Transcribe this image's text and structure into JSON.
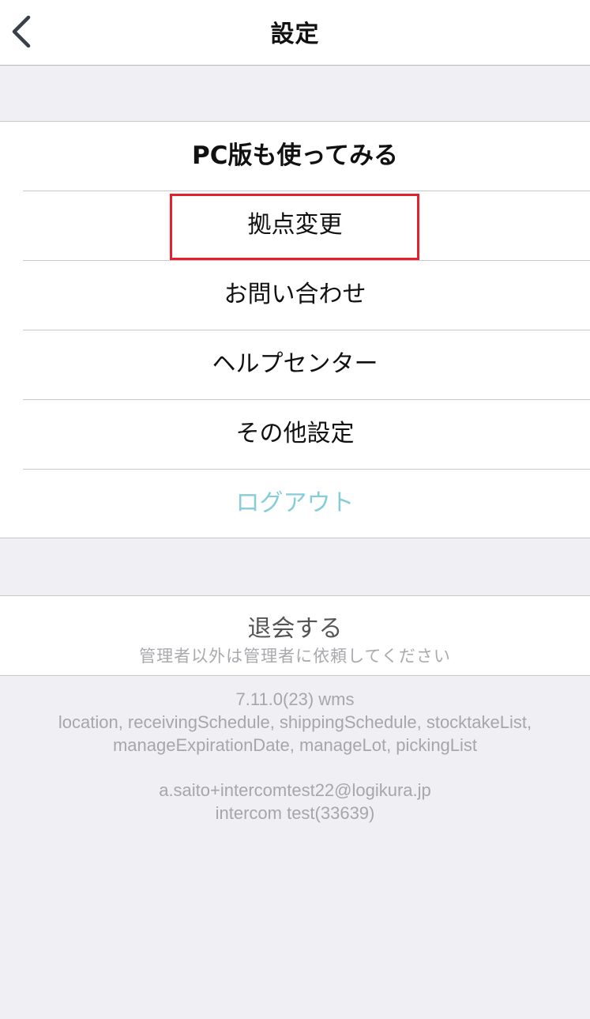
{
  "navbar": {
    "title": "設定",
    "back_icon": "chevron-left-icon"
  },
  "menu": {
    "items": [
      {
        "label": "PC版も使ってみる"
      },
      {
        "label": "拠点変更"
      },
      {
        "label": "お問い合わせ"
      },
      {
        "label": "ヘルプセンター"
      },
      {
        "label": "その他設定"
      },
      {
        "label": "ログアウト"
      }
    ],
    "logout_color": "#86cdd7",
    "highlight_color": "#e5202a"
  },
  "withdraw": {
    "label": "退会する",
    "note": "管理者以外は管理者に依頼してください"
  },
  "footer": {
    "version": "7.11.0(23) wms",
    "features_line1": "location, receivingSchedule, shippingSchedule, stocktakeList,",
    "features_line2": "manageExpirationDate, manageLot, pickingList",
    "email": "a.saito+intercomtest22@logikura.jp",
    "account": "intercom test(33639)"
  }
}
